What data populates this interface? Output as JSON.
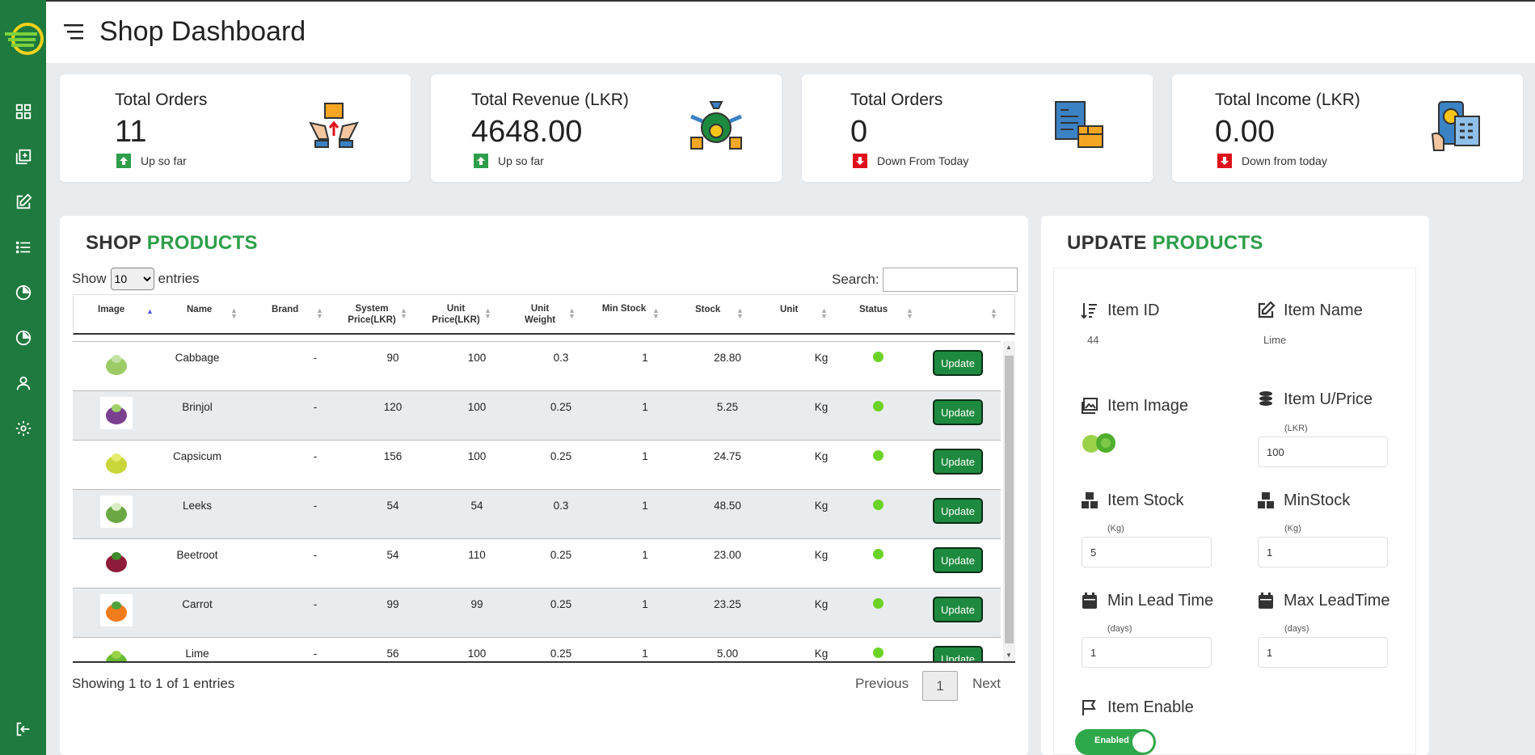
{
  "header": {
    "title": "Shop Dashboard"
  },
  "sidebar": {
    "items": [
      "logo",
      "dashboard-icon",
      "add-item-icon",
      "edit-icon",
      "list-icon",
      "pie-chart-icon",
      "pie-chart-icon-2",
      "user-icon",
      "settings-icon",
      "logout-icon"
    ]
  },
  "stats": [
    {
      "label": "Total Orders",
      "value": "11",
      "trend": "Up so far",
      "direction": "up",
      "icon": "hands-package-icon"
    },
    {
      "label": "Total Revenue (LKR)",
      "value": "4648.00",
      "trend": "Up so far",
      "direction": "up",
      "icon": "money-bag-icon"
    },
    {
      "label": "Total Orders",
      "value": "0",
      "trend": "Down From Today",
      "direction": "down",
      "icon": "invoice-icon"
    },
    {
      "label": "Total Income (LKR)",
      "value": "0.00",
      "trend": "Down from today",
      "direction": "down",
      "icon": "calculator-icon"
    }
  ],
  "products_panel": {
    "title_dark": "SHOP",
    "title_green": "PRODUCTS",
    "show_label": "Show",
    "entries_label": "entries",
    "page_size": "10",
    "search_label": "Search:",
    "columns": [
      "Image",
      "Name",
      "Brand",
      "System Price(LKR)",
      "Unit Price(LKR)",
      "Unit Weight",
      "Min Stock",
      "Stock",
      "Unit",
      "Status",
      ""
    ],
    "rows": [
      {
        "name": "Cabbage",
        "brand": "-",
        "system_price": "90",
        "unit_price": "100",
        "unit_weight": "0.3",
        "min_stock": "1",
        "stock": "28.80",
        "unit": "Kg",
        "status": "active",
        "image": "cabbage-image"
      },
      {
        "name": "Brinjol",
        "brand": "-",
        "system_price": "120",
        "unit_price": "100",
        "unit_weight": "0.25",
        "min_stock": "1",
        "stock": "5.25",
        "unit": "Kg",
        "status": "active",
        "image": "brinjal-image"
      },
      {
        "name": "Capsicum",
        "brand": "-",
        "system_price": "156",
        "unit_price": "100",
        "unit_weight": "0.25",
        "min_stock": "1",
        "stock": "24.75",
        "unit": "Kg",
        "status": "active",
        "image": "capsicum-image"
      },
      {
        "name": "Leeks",
        "brand": "-",
        "system_price": "54",
        "unit_price": "54",
        "unit_weight": "0.3",
        "min_stock": "1",
        "stock": "48.50",
        "unit": "Kg",
        "status": "active",
        "image": "leeks-image"
      },
      {
        "name": "Beetroot",
        "brand": "-",
        "system_price": "54",
        "unit_price": "110",
        "unit_weight": "0.25",
        "min_stock": "1",
        "stock": "23.00",
        "unit": "Kg",
        "status": "active",
        "image": "beetroot-image"
      },
      {
        "name": "Carrot",
        "brand": "-",
        "system_price": "99",
        "unit_price": "99",
        "unit_weight": "0.25",
        "min_stock": "1",
        "stock": "23.25",
        "unit": "Kg",
        "status": "active",
        "image": "carrot-image"
      },
      {
        "name": "Lime",
        "brand": "-",
        "system_price": "56",
        "unit_price": "100",
        "unit_weight": "0.25",
        "min_stock": "1",
        "stock": "5.00",
        "unit": "Kg",
        "status": "active",
        "image": "lime-image"
      }
    ],
    "update_label": "Update",
    "info": "Showing 1 to 1 of 1 entries",
    "prev_label": "Previous",
    "current_page": "1",
    "next_label": "Next"
  },
  "update_panel": {
    "title_dark": "UPDATE",
    "title_green": "PRODUCTS",
    "item_id_label": "Item ID",
    "item_id": "44",
    "item_name_label": "Item Name",
    "item_name": "Lime",
    "item_image_label": "Item Image",
    "item_price_label": "Item U/Price",
    "price_unit": "(LKR)",
    "price_value": "100",
    "item_stock_label": "Item Stock",
    "stock_unit": "(Kg)",
    "stock_value": "5",
    "min_stock_label": "MinStock",
    "min_stock_unit": "(Kg)",
    "min_stock_value": "1",
    "min_lead_label": "Min Lead Time",
    "min_lead_unit": "(days)",
    "min_lead_value": "1",
    "max_lead_label": "Max LeadTime",
    "max_lead_unit": "(days)",
    "max_lead_value": "1",
    "enable_label": "Item Enable",
    "toggle_text": "Enabled"
  },
  "colors": {
    "brand": "#1e7a3e",
    "accent": "#2e9e4a",
    "status_active": "#6bd326",
    "up": "#2e9e4a",
    "down": "#e0101b"
  }
}
